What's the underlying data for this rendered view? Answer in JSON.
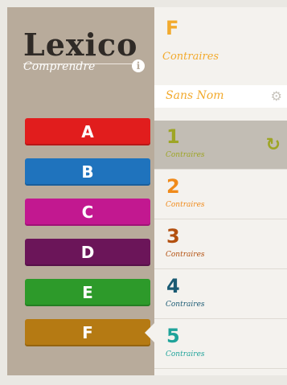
{
  "sidebar": {
    "logo": "Lexico",
    "subtitle": "Comprendre",
    "info_icon": "info-icon",
    "levels": [
      {
        "label": "A",
        "color": "#e11d1d"
      },
      {
        "label": "B",
        "color": "#1f73bd"
      },
      {
        "label": "C",
        "color": "#c21890"
      },
      {
        "label": "D",
        "color": "#6b1559"
      },
      {
        "label": "E",
        "color": "#2d9a2a"
      },
      {
        "label": "F",
        "color": "#b57a13"
      }
    ]
  },
  "panel": {
    "letter": "F",
    "subtitle": "Contraires",
    "accent": "#f2aa2d",
    "user": {
      "name": "Sans Nom",
      "icon": "gear-icon"
    },
    "items": [
      {
        "num": "1",
        "label": "Contraires",
        "color": "#9ea525",
        "selected": true,
        "icon": "refresh-icon"
      },
      {
        "num": "2",
        "label": "Contraires",
        "color": "#f08a1a"
      },
      {
        "num": "3",
        "label": "Contraires",
        "color": "#b3500f"
      },
      {
        "num": "4",
        "label": "Contraires",
        "color": "#1a5a73"
      },
      {
        "num": "5",
        "label": "Contraires",
        "color": "#1fa39a"
      }
    ]
  }
}
